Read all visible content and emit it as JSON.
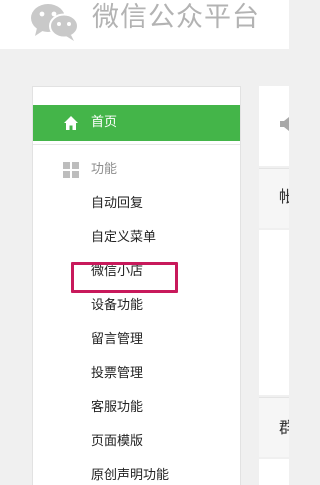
{
  "header": {
    "title": "微信公众平台",
    "logo_icon": "wechat-logo-icon"
  },
  "sidebar": {
    "home": {
      "label": "首页",
      "icon": "home-icon"
    },
    "section": {
      "label": "功能",
      "icon": "grid-icon"
    },
    "items": [
      {
        "label": "自动回复"
      },
      {
        "label": "自定义菜单"
      },
      {
        "label": "微信小店"
      },
      {
        "label": "设备功能"
      },
      {
        "label": "留言管理"
      },
      {
        "label": "投票管理"
      },
      {
        "label": "客服功能"
      },
      {
        "label": "页面模版"
      },
      {
        "label": "原创声明功能"
      }
    ]
  },
  "content": {
    "notice_icon": "speaker-icon",
    "clipped_text_1": "帐",
    "clipped_text_2": "群"
  },
  "colors": {
    "accent_green": "#44b549",
    "highlight_annotation": "#c8195b",
    "logo_gray": "#b3b3b3"
  }
}
